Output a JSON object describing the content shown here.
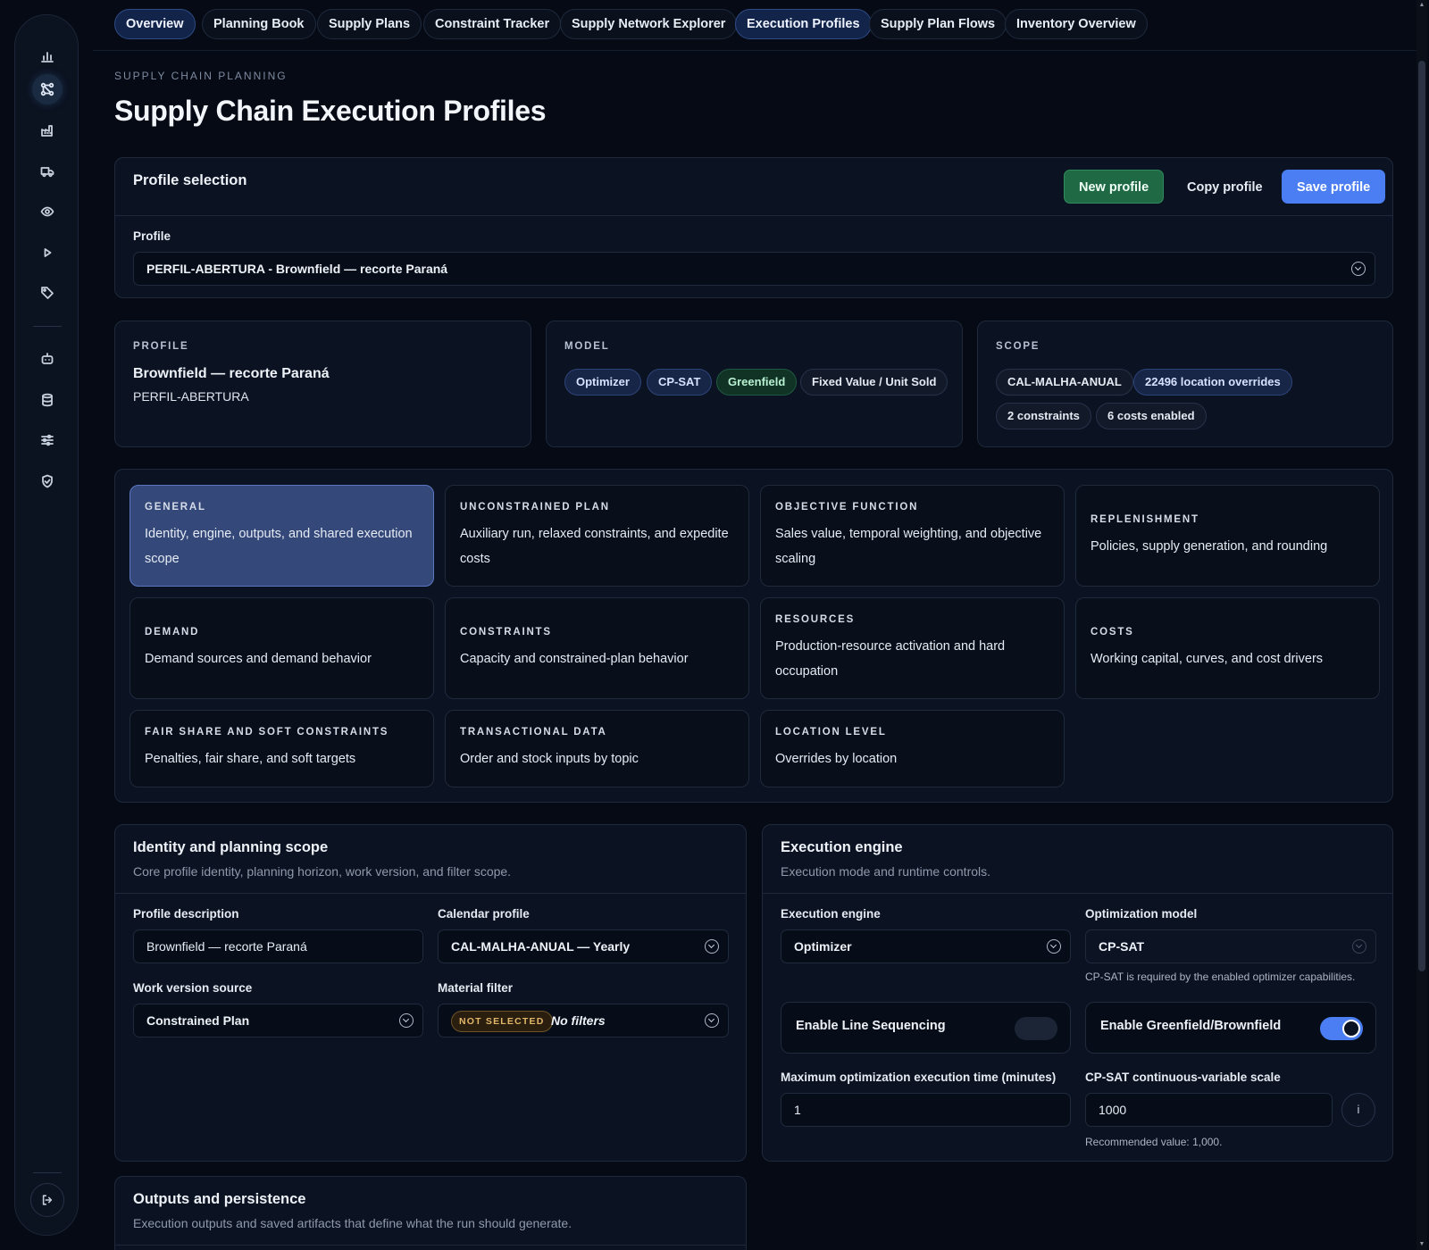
{
  "tabs": [
    {
      "label": "Overview",
      "active": true
    },
    {
      "label": "Planning Book",
      "active": false
    },
    {
      "label": "Supply Plans",
      "active": false
    },
    {
      "label": "Constraint Tracker",
      "active": false
    },
    {
      "label": "Supply Network Explorer",
      "active": false
    },
    {
      "label": "Execution Profiles",
      "active": true
    },
    {
      "label": "Supply Plan Flows",
      "active": false
    },
    {
      "label": "Inventory Overview",
      "active": false
    }
  ],
  "sidebar": {
    "icons": [
      "bar-chart-icon",
      "workflow-icon",
      "factory-icon",
      "truck-icon",
      "eye-icon",
      "play-icon",
      "tag-icon",
      "robot-icon",
      "database-icon",
      "sliders-icon",
      "shield-check-icon"
    ],
    "active_index": 1,
    "logout_icon": "logout-icon"
  },
  "header": {
    "eyebrow": "SUPPLY CHAIN PLANNING",
    "title": "Supply Chain Execution Profiles"
  },
  "profile_selection": {
    "title": "Profile selection",
    "new_label": "New profile",
    "copy_label": "Copy profile",
    "save_label": "Save profile",
    "profile_label": "Profile",
    "profile_value": "PERFIL-ABERTURA - Brownfield — recorte Paraná"
  },
  "summary": {
    "profile": {
      "eyebrow": "PROFILE",
      "name": "Brownfield — recorte Paraná",
      "code": "PERFIL-ABERTURA"
    },
    "model": {
      "eyebrow": "MODEL",
      "pills": [
        "Optimizer",
        "CP-SAT",
        "Greenfield",
        "Fixed Value / Unit Sold"
      ]
    },
    "scope": {
      "eyebrow": "SCOPE",
      "pills": [
        "CAL-MALHA-ANUAL",
        "22496 location overrides",
        "2 constraints",
        "6 costs enabled"
      ]
    }
  },
  "sections": [
    {
      "eyebrow": "GENERAL",
      "desc": "Identity, engine, outputs, and shared execution scope"
    },
    {
      "eyebrow": "UNCONSTRAINED PLAN",
      "desc": "Auxiliary run, relaxed constraints, and expedite costs"
    },
    {
      "eyebrow": "OBJECTIVE FUNCTION",
      "desc": "Sales value, temporal weighting, and objective scaling"
    },
    {
      "eyebrow": "REPLENISHMENT",
      "desc": "Policies, supply generation, and rounding"
    },
    {
      "eyebrow": "DEMAND",
      "desc": "Demand sources and demand behavior"
    },
    {
      "eyebrow": "CONSTRAINTS",
      "desc": "Capacity and constrained-plan behavior"
    },
    {
      "eyebrow": "RESOURCES",
      "desc": "Production-resource activation and hard occupation"
    },
    {
      "eyebrow": "COSTS",
      "desc": "Working capital, curves, and cost drivers"
    },
    {
      "eyebrow": "FAIR SHARE AND SOFT CONSTRAINTS",
      "desc": "Penalties, fair share, and soft targets"
    },
    {
      "eyebrow": "TRANSACTIONAL DATA",
      "desc": "Order and stock inputs by topic"
    },
    {
      "eyebrow": "LOCATION LEVEL",
      "desc": "Overrides by location"
    }
  ],
  "identity": {
    "title": "Identity and planning scope",
    "subtitle": "Core profile identity, planning horizon, work version, and filter scope.",
    "desc_label": "Profile description",
    "desc_value": "Brownfield — recorte Paraná",
    "calendar_label": "Calendar profile",
    "calendar_value": "CAL-MALHA-ANUAL — Yearly",
    "work_label": "Work version source",
    "work_value": "Constrained Plan",
    "material_label": "Material filter",
    "material_badge": "NOT SELECTED",
    "material_value": "No filters"
  },
  "engine": {
    "title": "Execution engine",
    "subtitle": "Execution mode and runtime controls.",
    "engine_label": "Execution engine",
    "engine_value": "Optimizer",
    "model_label": "Optimization model",
    "model_value": "CP-SAT",
    "model_help": "CP-SAT is required by the enabled optimizer capabilities.",
    "line_seq_label": "Enable Line Sequencing",
    "line_seq_on": false,
    "green_label": "Enable Greenfield/Brownfield",
    "green_on": true,
    "max_time_label": "Maximum optimization execution time (minutes)",
    "max_time_value": "1",
    "scale_label": "CP-SAT continuous-variable scale",
    "scale_value": "1000",
    "scale_help": "Recommended value: 1,000.",
    "info_glyph": "i"
  },
  "outputs": {
    "title": "Outputs and persistence",
    "subtitle": "Execution outputs and saved artifacts that define what the run should generate."
  }
}
